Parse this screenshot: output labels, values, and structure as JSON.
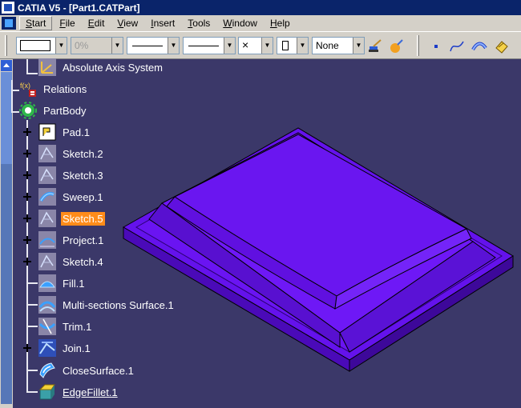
{
  "window": {
    "title": "CATIA V5 - [Part1.CATPart]"
  },
  "menu": {
    "items": [
      "Start",
      "File",
      "Edit",
      "View",
      "Insert",
      "Tools",
      "Window",
      "Help"
    ]
  },
  "toolbar": {
    "color_value": "",
    "transparency_value": "0%",
    "line_thickness_value": "",
    "line_type_value": "",
    "point_symbol_value": "×",
    "layer_value": "",
    "render_style_value": "None"
  },
  "tree": {
    "items": [
      {
        "label": "Absolute Axis System",
        "icon": "axis-system-icon",
        "expandable": false
      },
      {
        "label": "Relations",
        "icon": "relations-icon",
        "expandable": false
      },
      {
        "label": "PartBody",
        "icon": "partbody-gear-icon",
        "expandable": false
      },
      {
        "label": "Pad.1",
        "icon": "pad-icon",
        "expandable": true
      },
      {
        "label": "Sketch.2",
        "icon": "sketch-icon",
        "expandable": true
      },
      {
        "label": "Sketch.3",
        "icon": "sketch-icon",
        "expandable": true
      },
      {
        "label": "Sweep.1",
        "icon": "sweep-icon",
        "expandable": true
      },
      {
        "label": "Sketch.5",
        "icon": "sketch-icon",
        "expandable": true,
        "selected": true
      },
      {
        "label": "Project.1",
        "icon": "project-icon",
        "expandable": true
      },
      {
        "label": "Sketch.4",
        "icon": "sketch-icon",
        "expandable": true
      },
      {
        "label": "Fill.1",
        "icon": "fill-icon",
        "expandable": false
      },
      {
        "label": "Multi-sections Surface.1",
        "icon": "multisection-surface-icon",
        "expandable": false
      },
      {
        "label": "Trim.1",
        "icon": "trim-icon",
        "expandable": false
      },
      {
        "label": "Join.1",
        "icon": "join-icon",
        "expandable": true
      },
      {
        "label": "CloseSurface.1",
        "icon": "close-surface-icon",
        "expandable": false
      },
      {
        "label": "EdgeFillet.1",
        "icon": "edge-fillet-icon",
        "expandable": false,
        "underlined": true
      }
    ]
  },
  "colors": {
    "background": "#3b3869",
    "selection": "#ff8c1a",
    "model_top": "#6a13f0",
    "model_side": "#4a0ab8",
    "title_bar": "#0a246a"
  }
}
